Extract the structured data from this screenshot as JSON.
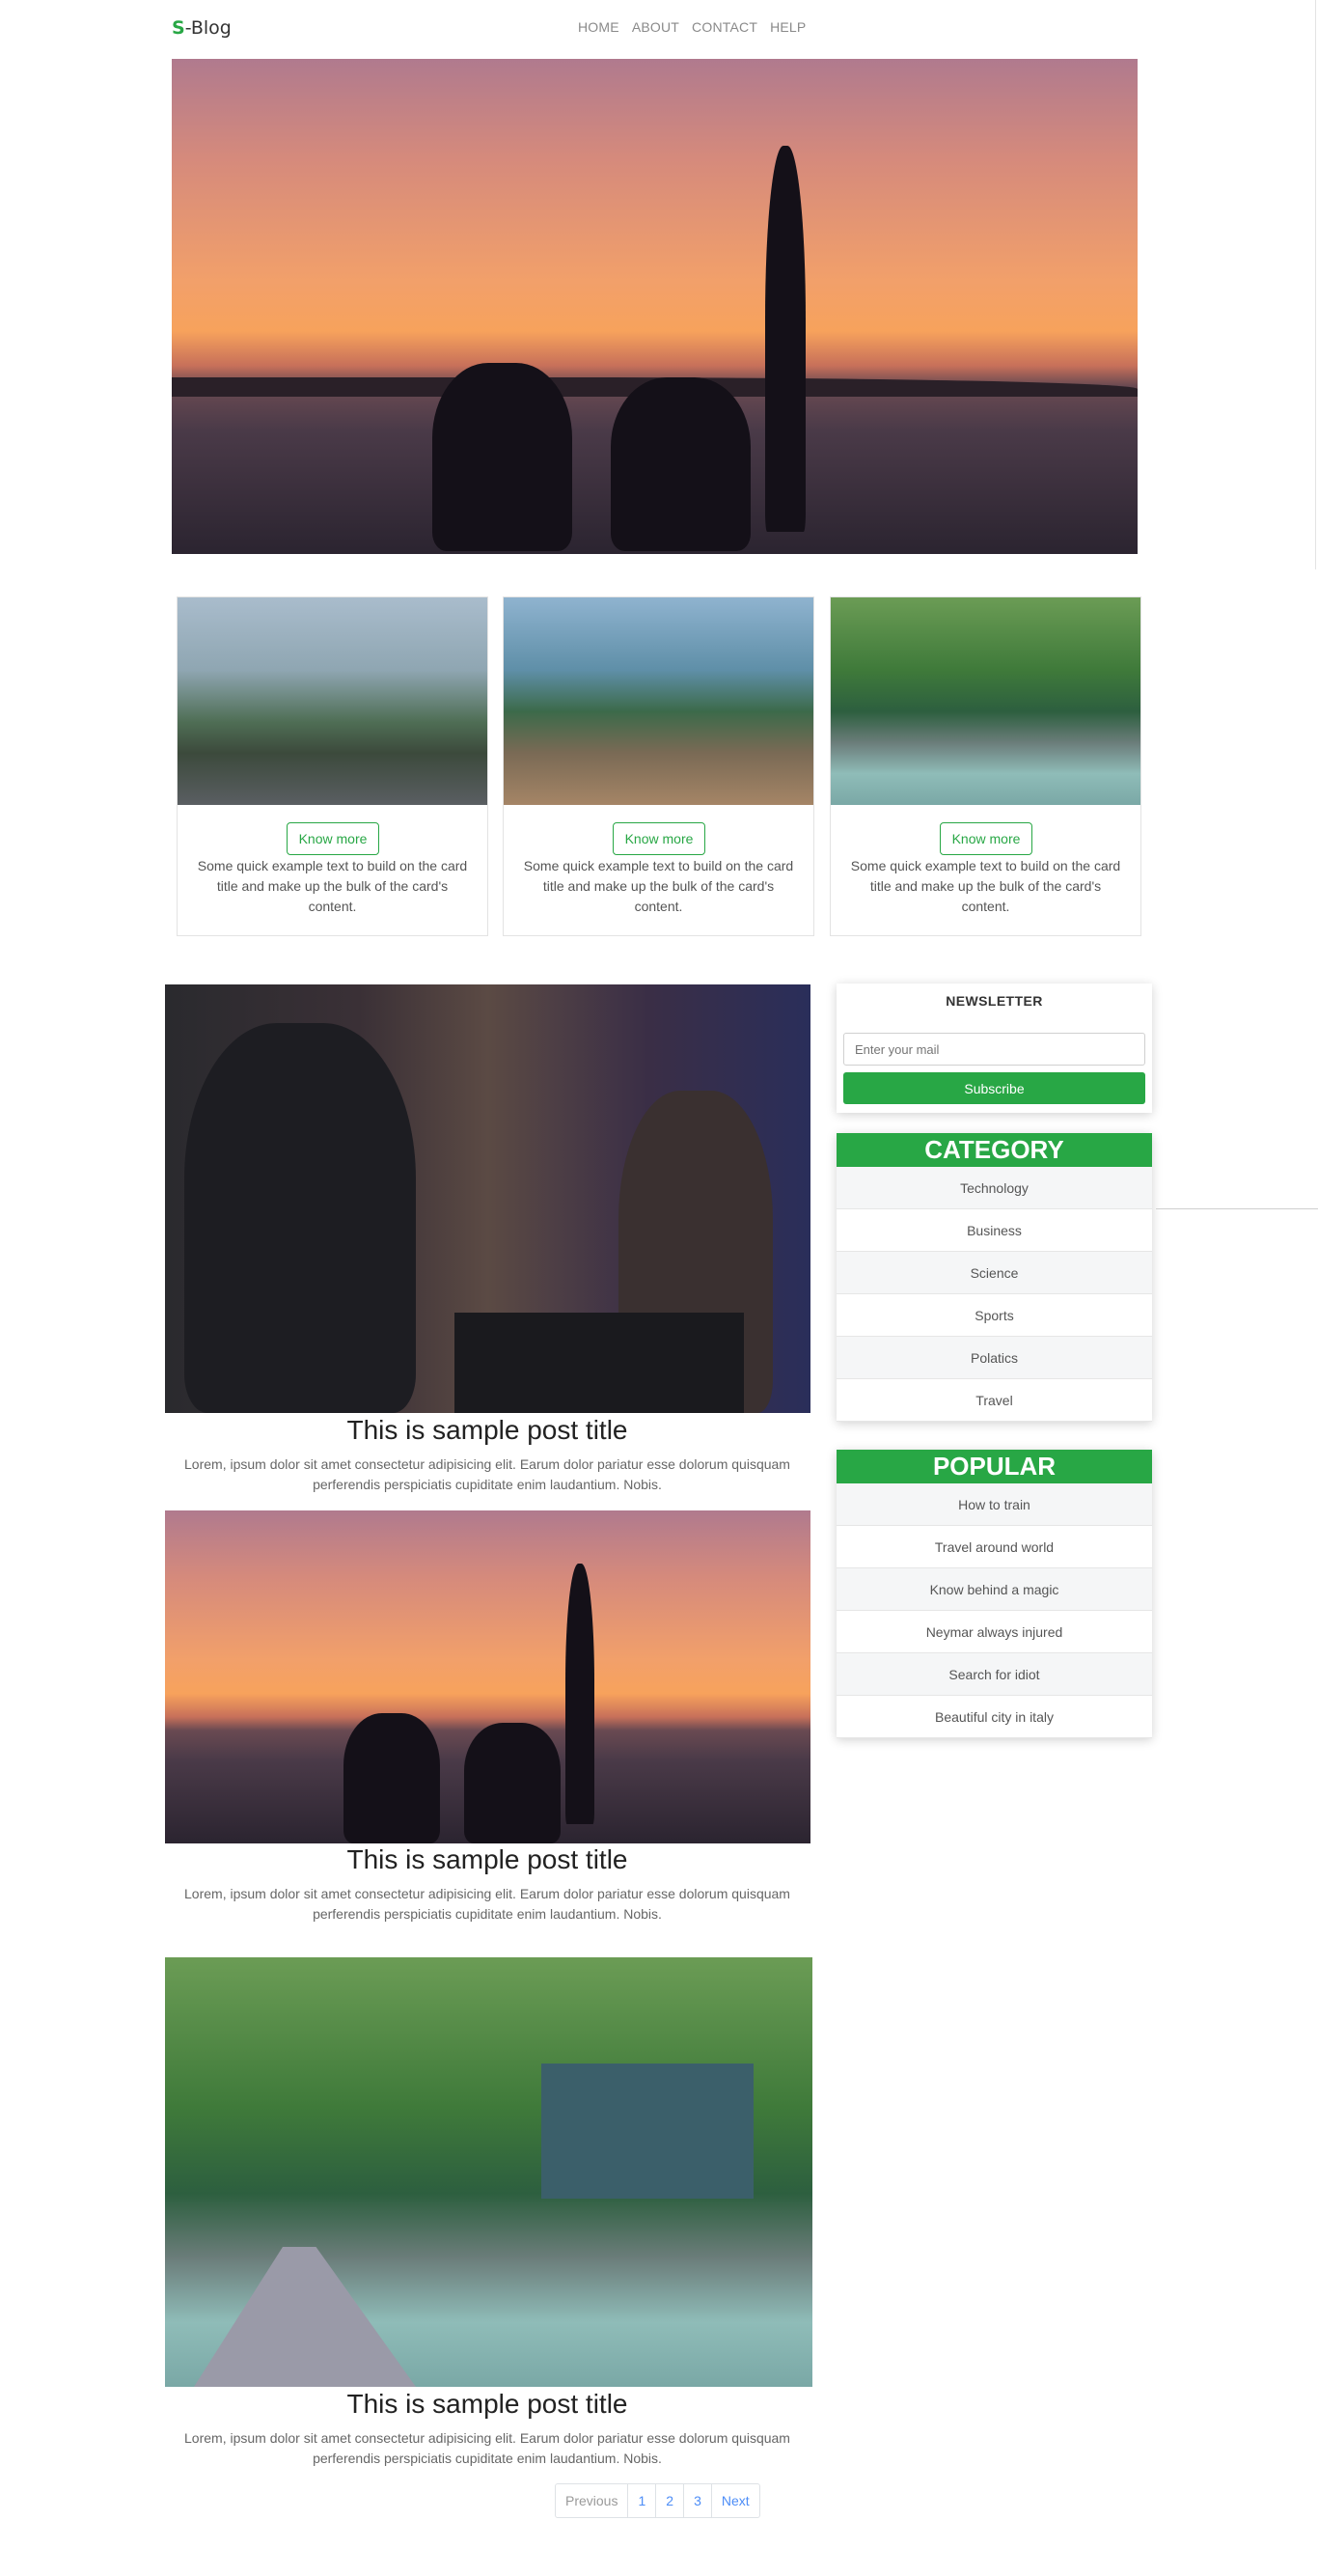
{
  "navbar": {
    "brand_prefix": "S",
    "brand_suffix": "-Blog",
    "links": [
      "HOME",
      "ABOUT",
      "CONTACT",
      "HELP"
    ]
  },
  "cards": [
    {
      "button": "Know more",
      "text": "Some quick example text to build on the card title and make up the bulk of the card's content."
    },
    {
      "button": "Know more",
      "text": "Some quick example text to build on the card title and make up the bulk of the card's content."
    },
    {
      "button": "Know more",
      "text": "Some quick example text to build on the card title and make up the bulk of the card's content."
    }
  ],
  "posts": [
    {
      "title": "This is sample post title",
      "text": "Lorem, ipsum dolor sit amet consectetur adipisicing elit. Earum dolor pariatur esse dolorum quisquam perferendis perspiciatis cupiditate enim laudantium. Nobis."
    },
    {
      "title": "This is sample post title",
      "text": "Lorem, ipsum dolor sit amet consectetur adipisicing elit. Earum dolor pariatur esse dolorum quisquam perferendis perspiciatis cupiditate enim laudantium. Nobis."
    },
    {
      "title": "This is sample post title",
      "text": "Lorem, ipsum dolor sit amet consectetur adipisicing elit. Earum dolor pariatur esse dolorum quisquam perferendis perspiciatis cupiditate enim laudantium. Nobis."
    }
  ],
  "newsletter": {
    "title": "NEWSLETTER",
    "placeholder": "Enter your mail",
    "button": "Subscribe"
  },
  "category": {
    "title": "CATEGORY",
    "items": [
      "Technology",
      "Business",
      "Science",
      "Sports",
      "Polatics",
      "Travel"
    ]
  },
  "popular": {
    "title": "POPULAR",
    "items": [
      "How to train",
      "Travel around world",
      "Know behind a magic",
      "Neymar always injured",
      "Search for idiot",
      "Beautiful city in italy"
    ]
  },
  "pagination": {
    "previous": "Previous",
    "pages": [
      "1",
      "2",
      "3"
    ],
    "next": "Next"
  },
  "colors": {
    "accent": "#28a745",
    "link": "#4d8df7"
  }
}
